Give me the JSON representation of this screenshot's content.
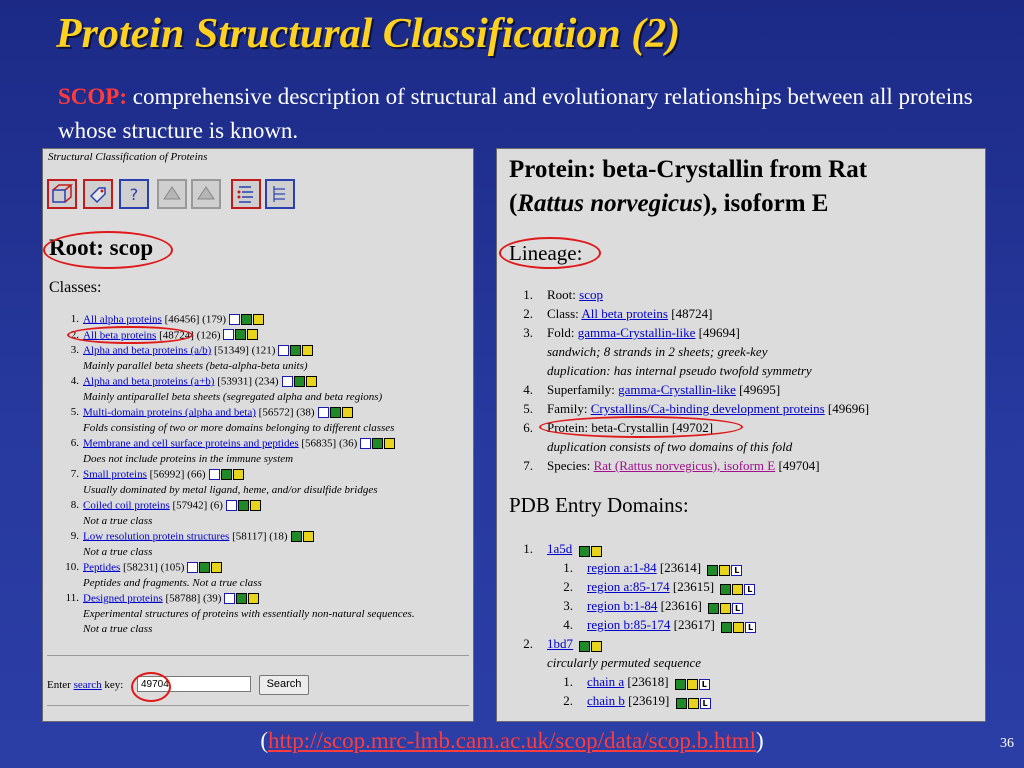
{
  "slide": {
    "title": "Protein Structural Classification (2)",
    "keyword": "SCOP:",
    "subtitle": "comprehensive description of  structural and evolutionary relationships between all proteins whose structure is known.",
    "footer_open": "(",
    "footer_url": "http://scop.mrc-lmb.cam.ac.uk/scop/data/scop.b.html",
    "footer_close": ")",
    "page_number": "36"
  },
  "left_panel": {
    "title": "Structural Classification of Proteins",
    "toolbar": [
      "cube-icon",
      "tag-icon",
      "help-icon",
      "up-arrow-icon",
      "up-arrow-icon",
      "list-icon",
      "tree-icon"
    ],
    "help_glyph": "?",
    "root": "Root: scop",
    "classes_heading": "Classes:",
    "classes": [
      {
        "num": "1.",
        "link": "All alpha proteins",
        "meta": "[46456] (179)",
        "desc": ""
      },
      {
        "num": "2.",
        "link": "All beta proteins",
        "meta": "[48724] (126)",
        "desc": ""
      },
      {
        "num": "3.",
        "link": "Alpha and beta proteins (a/b)",
        "meta": "[51349] (121)",
        "desc": "Mainly parallel beta sheets (beta-alpha-beta units)"
      },
      {
        "num": "4.",
        "link": "Alpha and beta proteins (a+b)",
        "meta": "[53931] (234)",
        "desc": "Mainly antiparallel beta sheets (segregated alpha and beta regions)"
      },
      {
        "num": "5.",
        "link": "Multi-domain proteins (alpha and beta)",
        "meta": "[56572] (38)",
        "desc": "Folds consisting of two or more domains belonging to different classes"
      },
      {
        "num": "6.",
        "link": "Membrane and cell surface proteins and peptides",
        "meta": "[56835] (36)",
        "desc": "Does not include proteins in the immune system"
      },
      {
        "num": "7.",
        "link": "Small proteins",
        "meta": "[56992] (66)",
        "desc": "Usually dominated by metal ligand, heme, and/or disulfide bridges"
      },
      {
        "num": "8.",
        "link": "Coiled coil proteins",
        "meta": "[57942] (6)",
        "desc": "Not a true class"
      },
      {
        "num": "9.",
        "link": "Low resolution protein structures",
        "meta": "[58117] (18)",
        "desc": "Not a true class"
      },
      {
        "num": "10.",
        "link": "Peptides",
        "meta": "[58231] (105)",
        "desc": "Peptides and fragments. Not a true class"
      },
      {
        "num": "11.",
        "link": "Designed proteins",
        "meta": "[58788] (39)",
        "desc": "Experimental structures of proteins with essentially non-natural sequences."
      }
    ],
    "trailing_desc": "Not a true class",
    "search_label_pre": "Enter",
    "search_link": "search",
    "search_label_post": "key:",
    "search_value": "49704",
    "search_button": "Search"
  },
  "right_panel": {
    "title_line1": "Protein: beta-Crystallin from Rat",
    "title_open": "(",
    "title_species": "Rattus norvegicus",
    "title_rest": "), isoform E",
    "lineage_heading": "Lineage:",
    "lineage": [
      {
        "num": "1.",
        "label": "Root:",
        "link": "scop",
        "id": ""
      },
      {
        "num": "2.",
        "label": "Class:",
        "link": "All beta proteins",
        "id": "[48724]"
      },
      {
        "num": "3.",
        "label": "Fold:",
        "link": "gamma-Crystallin-like",
        "id": "[49694]"
      },
      {
        "num": "4.",
        "label": "Superfamily:",
        "link": "gamma-Crystallin-like",
        "id": "[49695]"
      },
      {
        "num": "5.",
        "label": "Family:",
        "link": "Crystallins/Ca-binding development proteins",
        "id": "[49696]"
      },
      {
        "num": "6.",
        "label": "Protein: beta-Crystallin [49702]",
        "link": "",
        "id": ""
      },
      {
        "num": "7.",
        "label": "Species:",
        "link": "Rat (Rattus norvegicus), isoform E",
        "id": "[49704]"
      }
    ],
    "fold_desc_1": "sandwich; 8 strands in 2 sheets; greek-key",
    "fold_desc_2": "duplication: has internal pseudo twofold symmetry",
    "protein_desc": "duplication consists of two domains of this fold",
    "pdb_heading": "PDB Entry Domains:",
    "pdb_entries": [
      {
        "num": "1.",
        "id": "1a5d",
        "regions": [
          {
            "num": "1.",
            "link": "region a:1-84",
            "id": "[23614]"
          },
          {
            "num": "2.",
            "link": "region a:85-174",
            "id": "[23615]"
          },
          {
            "num": "3.",
            "link": "region b:1-84",
            "id": "[23616]"
          },
          {
            "num": "4.",
            "link": "region b:85-174",
            "id": "[23617]"
          }
        ]
      },
      {
        "num": "2.",
        "id": "1bd7",
        "note": "circularly permuted sequence",
        "regions": [
          {
            "num": "1.",
            "link": "chain a",
            "id": "[23618]"
          },
          {
            "num": "2.",
            "link": "chain b",
            "id": "[23619]"
          }
        ]
      }
    ],
    "l_badge": "L"
  },
  "colors": {
    "title": "#ffd21f",
    "keyword": "#ff3b3b",
    "highlight_oval": "#e01818",
    "link": "#0000cc"
  }
}
